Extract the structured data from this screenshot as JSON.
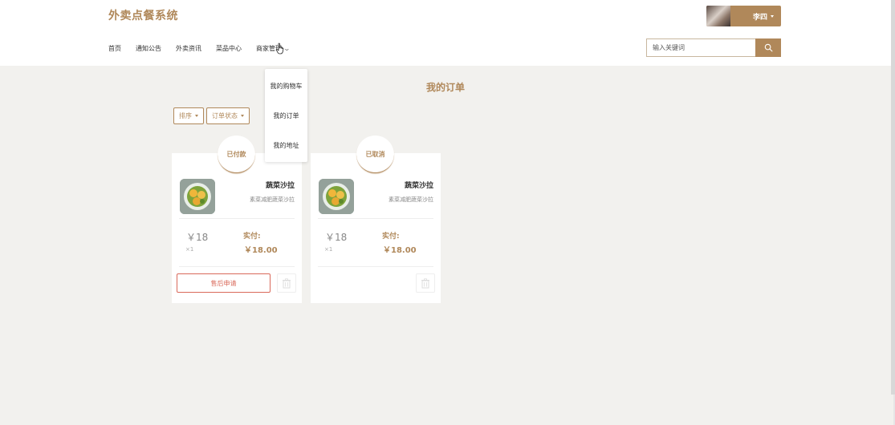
{
  "header": {
    "logo": "外卖点餐系统",
    "user_name": "李四"
  },
  "nav": {
    "items": [
      "首页",
      "通知公告",
      "外卖资讯",
      "菜品中心",
      "商家管理"
    ]
  },
  "search": {
    "placeholder": "输入关键词"
  },
  "dropdown": {
    "items": [
      "我的购物车",
      "我的订单",
      "我的地址"
    ]
  },
  "page": {
    "title": "我的订单"
  },
  "filters": {
    "sort_label": "排序",
    "status_label": "订单状态"
  },
  "orders": [
    {
      "status": "已付款",
      "name": "蔬菜沙拉",
      "desc": "素菜减肥蔬菜沙拉",
      "price": "￥18",
      "qty": "×1",
      "paid_label": "实付:",
      "paid_amount": "￥18.00",
      "after_sale_label": "售后申请"
    },
    {
      "status": "已取消",
      "name": "蔬菜沙拉",
      "desc": "素菜减肥蔬菜沙拉",
      "price": "￥18",
      "qty": "×1",
      "paid_label": "实付:",
      "paid_amount": "￥18.00"
    }
  ],
  "colors": {
    "accent": "#b0885a",
    "danger": "#d9695a",
    "background": "#f2f1ee"
  },
  "icons": {
    "search": "search-icon",
    "trash": "trash-icon",
    "chevron": "chevron-down-icon"
  }
}
